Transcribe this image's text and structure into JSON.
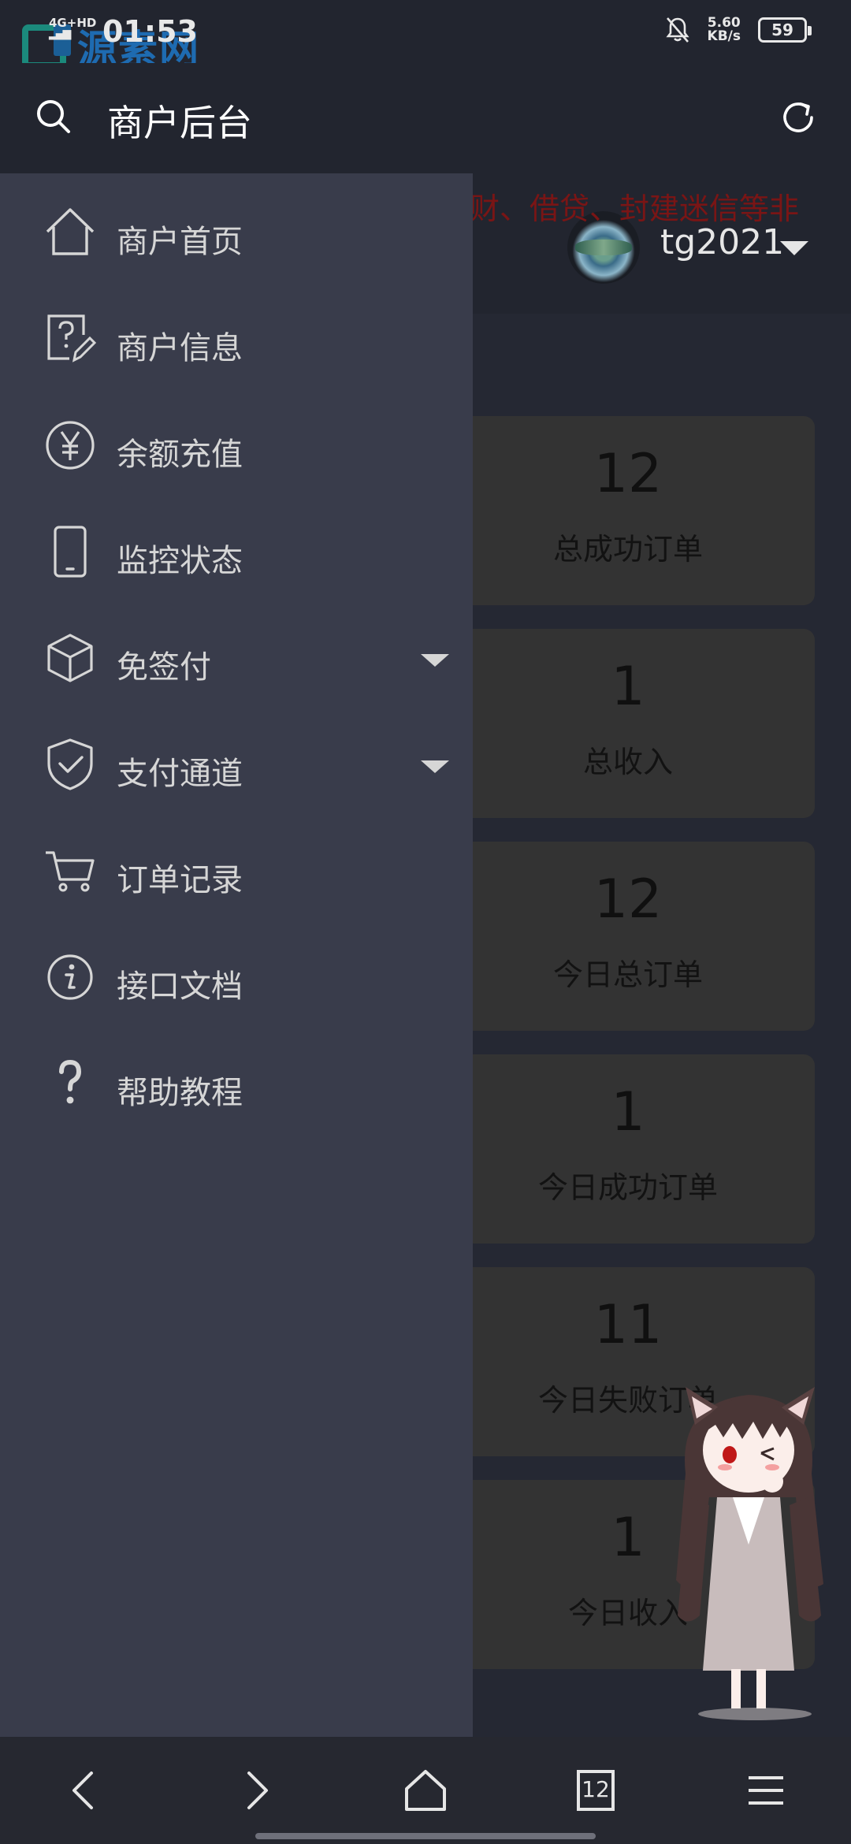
{
  "status_bar": {
    "network": "4G+HD",
    "time": "01:53",
    "speed_value": "5.60",
    "speed_unit": "KB/s",
    "battery": "59"
  },
  "watermark": {
    "text": "源素网"
  },
  "header": {
    "title": "商户后台"
  },
  "user": {
    "name": "tg2021"
  },
  "notice": {
    "text": "财、借贷、封建迷信等非"
  },
  "stats": [
    {
      "value": "12",
      "label": "总成功订单"
    },
    {
      "value": "1",
      "label": "总收入"
    },
    {
      "value": "12",
      "label": "今日总订单"
    },
    {
      "value": "1",
      "label": "今日成功订单"
    },
    {
      "value": "11",
      "label": "今日失败订单"
    },
    {
      "value": "1",
      "label": "今日收入"
    }
  ],
  "drawer": {
    "items": [
      {
        "label": "商户首页",
        "icon": "home-icon"
      },
      {
        "label": "商户信息",
        "icon": "edit-question-icon"
      },
      {
        "label": "余额充值",
        "icon": "yen-icon"
      },
      {
        "label": "监控状态",
        "icon": "phone-icon"
      },
      {
        "label": "免签付",
        "icon": "box-icon",
        "expandable": true
      },
      {
        "label": "支付通道",
        "icon": "shield-check-icon",
        "expandable": true
      },
      {
        "label": "订单记录",
        "icon": "cart-icon"
      },
      {
        "label": "接口文档",
        "icon": "info-icon"
      },
      {
        "label": "帮助教程",
        "icon": "question-icon"
      }
    ]
  },
  "bottom_nav": {
    "tabs_count": "12"
  },
  "colors": {
    "header_bg": "#22252f",
    "drawer_bg": "#393c4b",
    "card_bg": "#333333",
    "notice_red": "#7a1515"
  }
}
